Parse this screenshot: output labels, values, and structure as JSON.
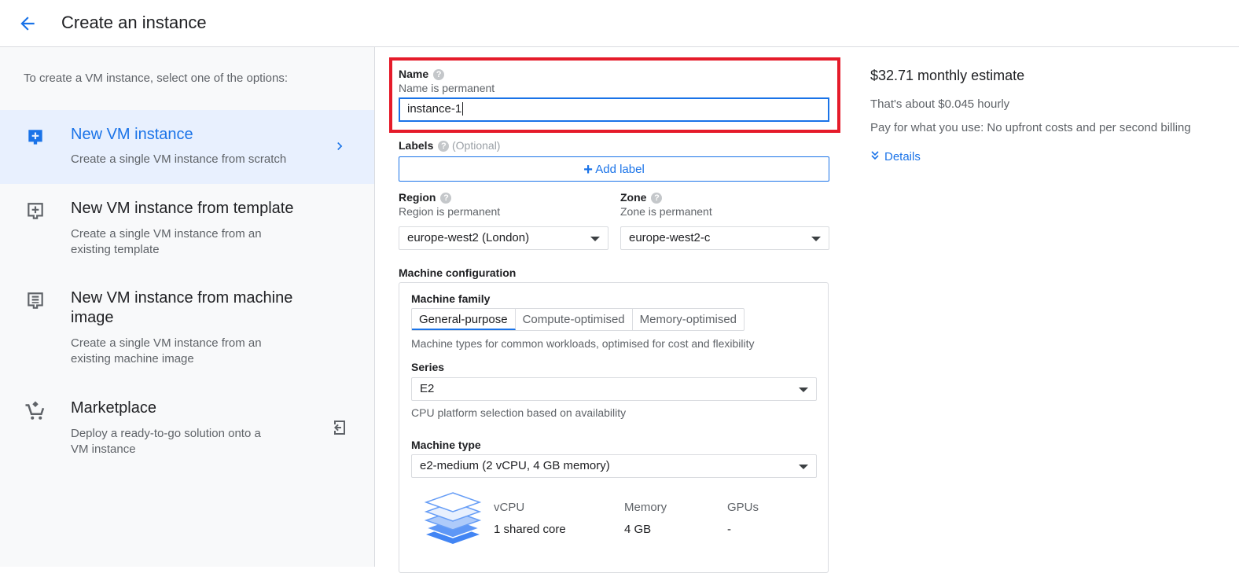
{
  "header": {
    "title": "Create an instance"
  },
  "sidebar": {
    "intro": "To create a VM instance, select one of the options:",
    "options": [
      {
        "title": "New VM instance",
        "desc": "Create a single VM instance from scratch"
      },
      {
        "title": "New VM instance from template",
        "desc": "Create a single VM instance from an existing template"
      },
      {
        "title": "New VM instance from machine image",
        "desc": "Create a single VM instance from an existing machine image"
      },
      {
        "title": "Marketplace",
        "desc": "Deploy a ready-to-go solution onto a VM instance"
      }
    ]
  },
  "form": {
    "name_label": "Name",
    "name_help": "?",
    "name_sub": "Name is permanent",
    "name_value": "instance-1",
    "labels_label": "Labels",
    "labels_optional": "(Optional)",
    "add_label": "Add label",
    "region_label": "Region",
    "region_sub": "Region is permanent",
    "region_value": "europe-west2 (London)",
    "zone_label": "Zone",
    "zone_sub": "Zone is permanent",
    "zone_value": "europe-west2-c",
    "machine_config_label": "Machine configuration",
    "machine_family_label": "Machine family",
    "family_tabs": [
      "General-purpose",
      "Compute-optimised",
      "Memory-optimised"
    ],
    "family_desc": "Machine types for common workloads, optimised for cost and flexibility",
    "series_label": "Series",
    "series_value": "E2",
    "series_desc": "CPU platform selection based on availability",
    "machine_type_label": "Machine type",
    "machine_type_value": "e2-medium (2 vCPU, 4 GB memory)",
    "specs": {
      "vcpu_h": "vCPU",
      "vcpu_v": "1 shared core",
      "memory_h": "Memory",
      "memory_v": "4 GB",
      "gpus_h": "GPUs",
      "gpus_v": "-"
    }
  },
  "estimate": {
    "title": "$32.71 monthly estimate",
    "hourly": "That's about $0.045 hourly",
    "billing": "Pay for what you use: No upfront costs and per second billing",
    "details": "Details"
  },
  "colors": {
    "accent": "#1a73e8",
    "highlight": "#e51b2a",
    "selected_bg": "#e8f0fe"
  }
}
